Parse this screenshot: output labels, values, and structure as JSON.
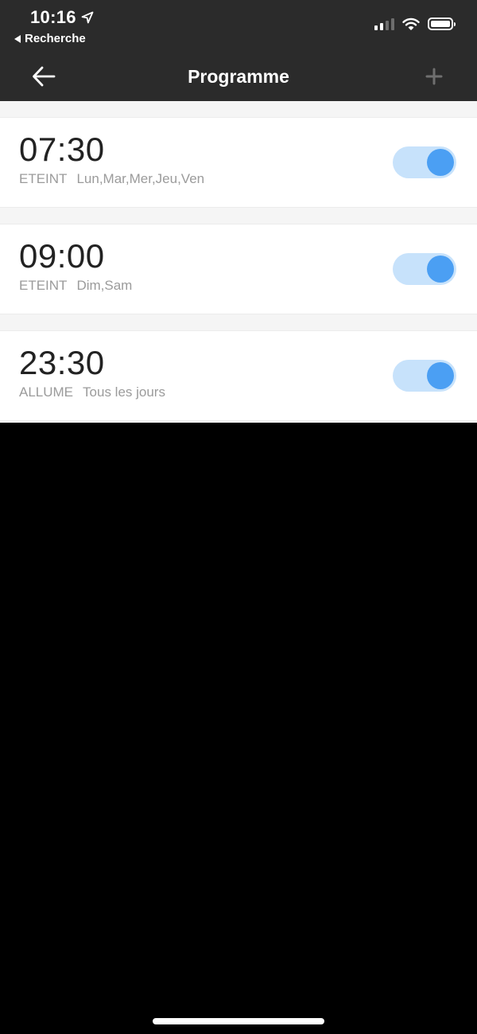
{
  "status_bar": {
    "time": "10:16",
    "back_app_label": "Recherche",
    "location_icon": "location-arrow-icon",
    "signal_icon": "cellular-signal-icon",
    "wifi_icon": "wifi-icon",
    "battery_icon": "battery-icon"
  },
  "nav": {
    "title": "Programme",
    "back_icon": "arrow-left-icon",
    "add_icon": "plus-icon"
  },
  "colors": {
    "header_bg": "#2b2b2b",
    "toggle_track": "#c7e2fb",
    "toggle_knob": "#4b9ff3",
    "secondary_text": "#9b9b9b"
  },
  "schedules": [
    {
      "time": "07:30",
      "action": "ETEINT",
      "days": "Lun,Mar,Mer,Jeu,Ven",
      "enabled": true
    },
    {
      "time": "09:00",
      "action": "ETEINT",
      "days": "Dim,Sam",
      "enabled": true
    },
    {
      "time": "23:30",
      "action": "ALLUME",
      "days": "Tous les jours",
      "enabled": true
    }
  ]
}
